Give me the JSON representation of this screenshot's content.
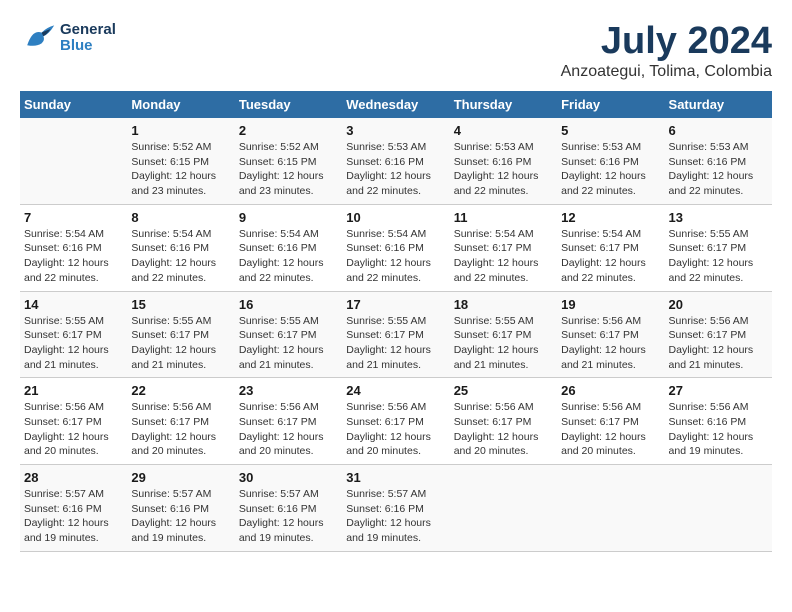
{
  "header": {
    "logo_general": "General",
    "logo_blue": "Blue",
    "title": "July 2024",
    "subtitle": "Anzoategui, Tolima, Colombia"
  },
  "calendar": {
    "days_of_week": [
      "Sunday",
      "Monday",
      "Tuesday",
      "Wednesday",
      "Thursday",
      "Friday",
      "Saturday"
    ],
    "weeks": [
      [
        {
          "day": "",
          "info": ""
        },
        {
          "day": "1",
          "info": "Sunrise: 5:52 AM\nSunset: 6:15 PM\nDaylight: 12 hours\nand 23 minutes."
        },
        {
          "day": "2",
          "info": "Sunrise: 5:52 AM\nSunset: 6:15 PM\nDaylight: 12 hours\nand 23 minutes."
        },
        {
          "day": "3",
          "info": "Sunrise: 5:53 AM\nSunset: 6:16 PM\nDaylight: 12 hours\nand 22 minutes."
        },
        {
          "day": "4",
          "info": "Sunrise: 5:53 AM\nSunset: 6:16 PM\nDaylight: 12 hours\nand 22 minutes."
        },
        {
          "day": "5",
          "info": "Sunrise: 5:53 AM\nSunset: 6:16 PM\nDaylight: 12 hours\nand 22 minutes."
        },
        {
          "day": "6",
          "info": "Sunrise: 5:53 AM\nSunset: 6:16 PM\nDaylight: 12 hours\nand 22 minutes."
        }
      ],
      [
        {
          "day": "7",
          "info": "Sunrise: 5:54 AM\nSunset: 6:16 PM\nDaylight: 12 hours\nand 22 minutes."
        },
        {
          "day": "8",
          "info": "Sunrise: 5:54 AM\nSunset: 6:16 PM\nDaylight: 12 hours\nand 22 minutes."
        },
        {
          "day": "9",
          "info": "Sunrise: 5:54 AM\nSunset: 6:16 PM\nDaylight: 12 hours\nand 22 minutes."
        },
        {
          "day": "10",
          "info": "Sunrise: 5:54 AM\nSunset: 6:16 PM\nDaylight: 12 hours\nand 22 minutes."
        },
        {
          "day": "11",
          "info": "Sunrise: 5:54 AM\nSunset: 6:17 PM\nDaylight: 12 hours\nand 22 minutes."
        },
        {
          "day": "12",
          "info": "Sunrise: 5:54 AM\nSunset: 6:17 PM\nDaylight: 12 hours\nand 22 minutes."
        },
        {
          "day": "13",
          "info": "Sunrise: 5:55 AM\nSunset: 6:17 PM\nDaylight: 12 hours\nand 22 minutes."
        }
      ],
      [
        {
          "day": "14",
          "info": "Sunrise: 5:55 AM\nSunset: 6:17 PM\nDaylight: 12 hours\nand 21 minutes."
        },
        {
          "day": "15",
          "info": "Sunrise: 5:55 AM\nSunset: 6:17 PM\nDaylight: 12 hours\nand 21 minutes."
        },
        {
          "day": "16",
          "info": "Sunrise: 5:55 AM\nSunset: 6:17 PM\nDaylight: 12 hours\nand 21 minutes."
        },
        {
          "day": "17",
          "info": "Sunrise: 5:55 AM\nSunset: 6:17 PM\nDaylight: 12 hours\nand 21 minutes."
        },
        {
          "day": "18",
          "info": "Sunrise: 5:55 AM\nSunset: 6:17 PM\nDaylight: 12 hours\nand 21 minutes."
        },
        {
          "day": "19",
          "info": "Sunrise: 5:56 AM\nSunset: 6:17 PM\nDaylight: 12 hours\nand 21 minutes."
        },
        {
          "day": "20",
          "info": "Sunrise: 5:56 AM\nSunset: 6:17 PM\nDaylight: 12 hours\nand 21 minutes."
        }
      ],
      [
        {
          "day": "21",
          "info": "Sunrise: 5:56 AM\nSunset: 6:17 PM\nDaylight: 12 hours\nand 20 minutes."
        },
        {
          "day": "22",
          "info": "Sunrise: 5:56 AM\nSunset: 6:17 PM\nDaylight: 12 hours\nand 20 minutes."
        },
        {
          "day": "23",
          "info": "Sunrise: 5:56 AM\nSunset: 6:17 PM\nDaylight: 12 hours\nand 20 minutes."
        },
        {
          "day": "24",
          "info": "Sunrise: 5:56 AM\nSunset: 6:17 PM\nDaylight: 12 hours\nand 20 minutes."
        },
        {
          "day": "25",
          "info": "Sunrise: 5:56 AM\nSunset: 6:17 PM\nDaylight: 12 hours\nand 20 minutes."
        },
        {
          "day": "26",
          "info": "Sunrise: 5:56 AM\nSunset: 6:17 PM\nDaylight: 12 hours\nand 20 minutes."
        },
        {
          "day": "27",
          "info": "Sunrise: 5:56 AM\nSunset: 6:16 PM\nDaylight: 12 hours\nand 19 minutes."
        }
      ],
      [
        {
          "day": "28",
          "info": "Sunrise: 5:57 AM\nSunset: 6:16 PM\nDaylight: 12 hours\nand 19 minutes."
        },
        {
          "day": "29",
          "info": "Sunrise: 5:57 AM\nSunset: 6:16 PM\nDaylight: 12 hours\nand 19 minutes."
        },
        {
          "day": "30",
          "info": "Sunrise: 5:57 AM\nSunset: 6:16 PM\nDaylight: 12 hours\nand 19 minutes."
        },
        {
          "day": "31",
          "info": "Sunrise: 5:57 AM\nSunset: 6:16 PM\nDaylight: 12 hours\nand 19 minutes."
        },
        {
          "day": "",
          "info": ""
        },
        {
          "day": "",
          "info": ""
        },
        {
          "day": "",
          "info": ""
        }
      ]
    ]
  }
}
